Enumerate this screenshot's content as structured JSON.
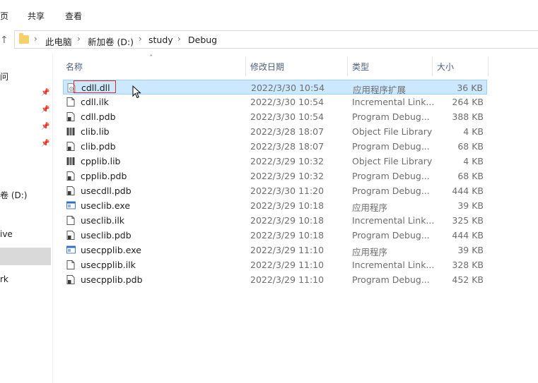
{
  "ribbon": {
    "tabs": [
      "页",
      "共享",
      "查看"
    ]
  },
  "breadcrumb": [
    "此电脑",
    "新加卷 (D:)",
    "study",
    "Debug"
  ],
  "nav": {
    "items": [
      "问",
      "卷 (D:)",
      "ive",
      "rk"
    ]
  },
  "columns": {
    "name": "名称",
    "date": "修改日期",
    "type": "类型",
    "size": "大小"
  },
  "files": [
    {
      "name": "cdll.dll",
      "date": "2022/3/30 10:54",
      "type": "应用程序扩展",
      "size": "36 KB",
      "icon": "dll-icon"
    },
    {
      "name": "cdll.ilk",
      "date": "2022/3/30 10:54",
      "type": "Incremental Link...",
      "size": "264 KB",
      "icon": "ilk-file-icon"
    },
    {
      "name": "cdll.pdb",
      "date": "2022/3/30 10:54",
      "type": "Program Debug...",
      "size": "388 KB",
      "icon": "pdb-file-icon"
    },
    {
      "name": "clib.lib",
      "date": "2022/3/28 18:07",
      "type": "Object File Library",
      "size": "4 KB",
      "icon": "lib-file-icon"
    },
    {
      "name": "clib.pdb",
      "date": "2022/3/28 18:07",
      "type": "Program Debug...",
      "size": "68 KB",
      "icon": "pdb-file-icon"
    },
    {
      "name": "cpplib.lib",
      "date": "2022/3/29 10:32",
      "type": "Object File Library",
      "size": "4 KB",
      "icon": "lib-file-icon"
    },
    {
      "name": "cpplib.pdb",
      "date": "2022/3/29 10:32",
      "type": "Program Debug...",
      "size": "68 KB",
      "icon": "pdb-file-icon"
    },
    {
      "name": "usecdll.pdb",
      "date": "2022/3/30 11:20",
      "type": "Program Debug...",
      "size": "444 KB",
      "icon": "pdb-file-icon"
    },
    {
      "name": "useclib.exe",
      "date": "2022/3/29 10:18",
      "type": "应用程序",
      "size": "39 KB",
      "icon": "exe-icon"
    },
    {
      "name": "useclib.ilk",
      "date": "2022/3/29 10:18",
      "type": "Incremental Link...",
      "size": "325 KB",
      "icon": "ilk-file-icon"
    },
    {
      "name": "useclib.pdb",
      "date": "2022/3/29 10:18",
      "type": "Program Debug...",
      "size": "444 KB",
      "icon": "pdb-file-icon"
    },
    {
      "name": "usecpplib.exe",
      "date": "2022/3/29 11:10",
      "type": "应用程序",
      "size": "39 KB",
      "icon": "exe-icon"
    },
    {
      "name": "usecpplib.ilk",
      "date": "2022/3/29 11:10",
      "type": "Incremental Link...",
      "size": "328 KB",
      "icon": "ilk-file-icon"
    },
    {
      "name": "usecpplib.pdb",
      "date": "2022/3/29 11:10",
      "type": "Program Debug...",
      "size": "452 KB",
      "icon": "pdb-file-icon"
    }
  ],
  "colors": {
    "selection": "#cce8ff",
    "selection_border": "#99d1ff",
    "rename_border": "#d92b2b",
    "folder": "#f8d06a"
  }
}
